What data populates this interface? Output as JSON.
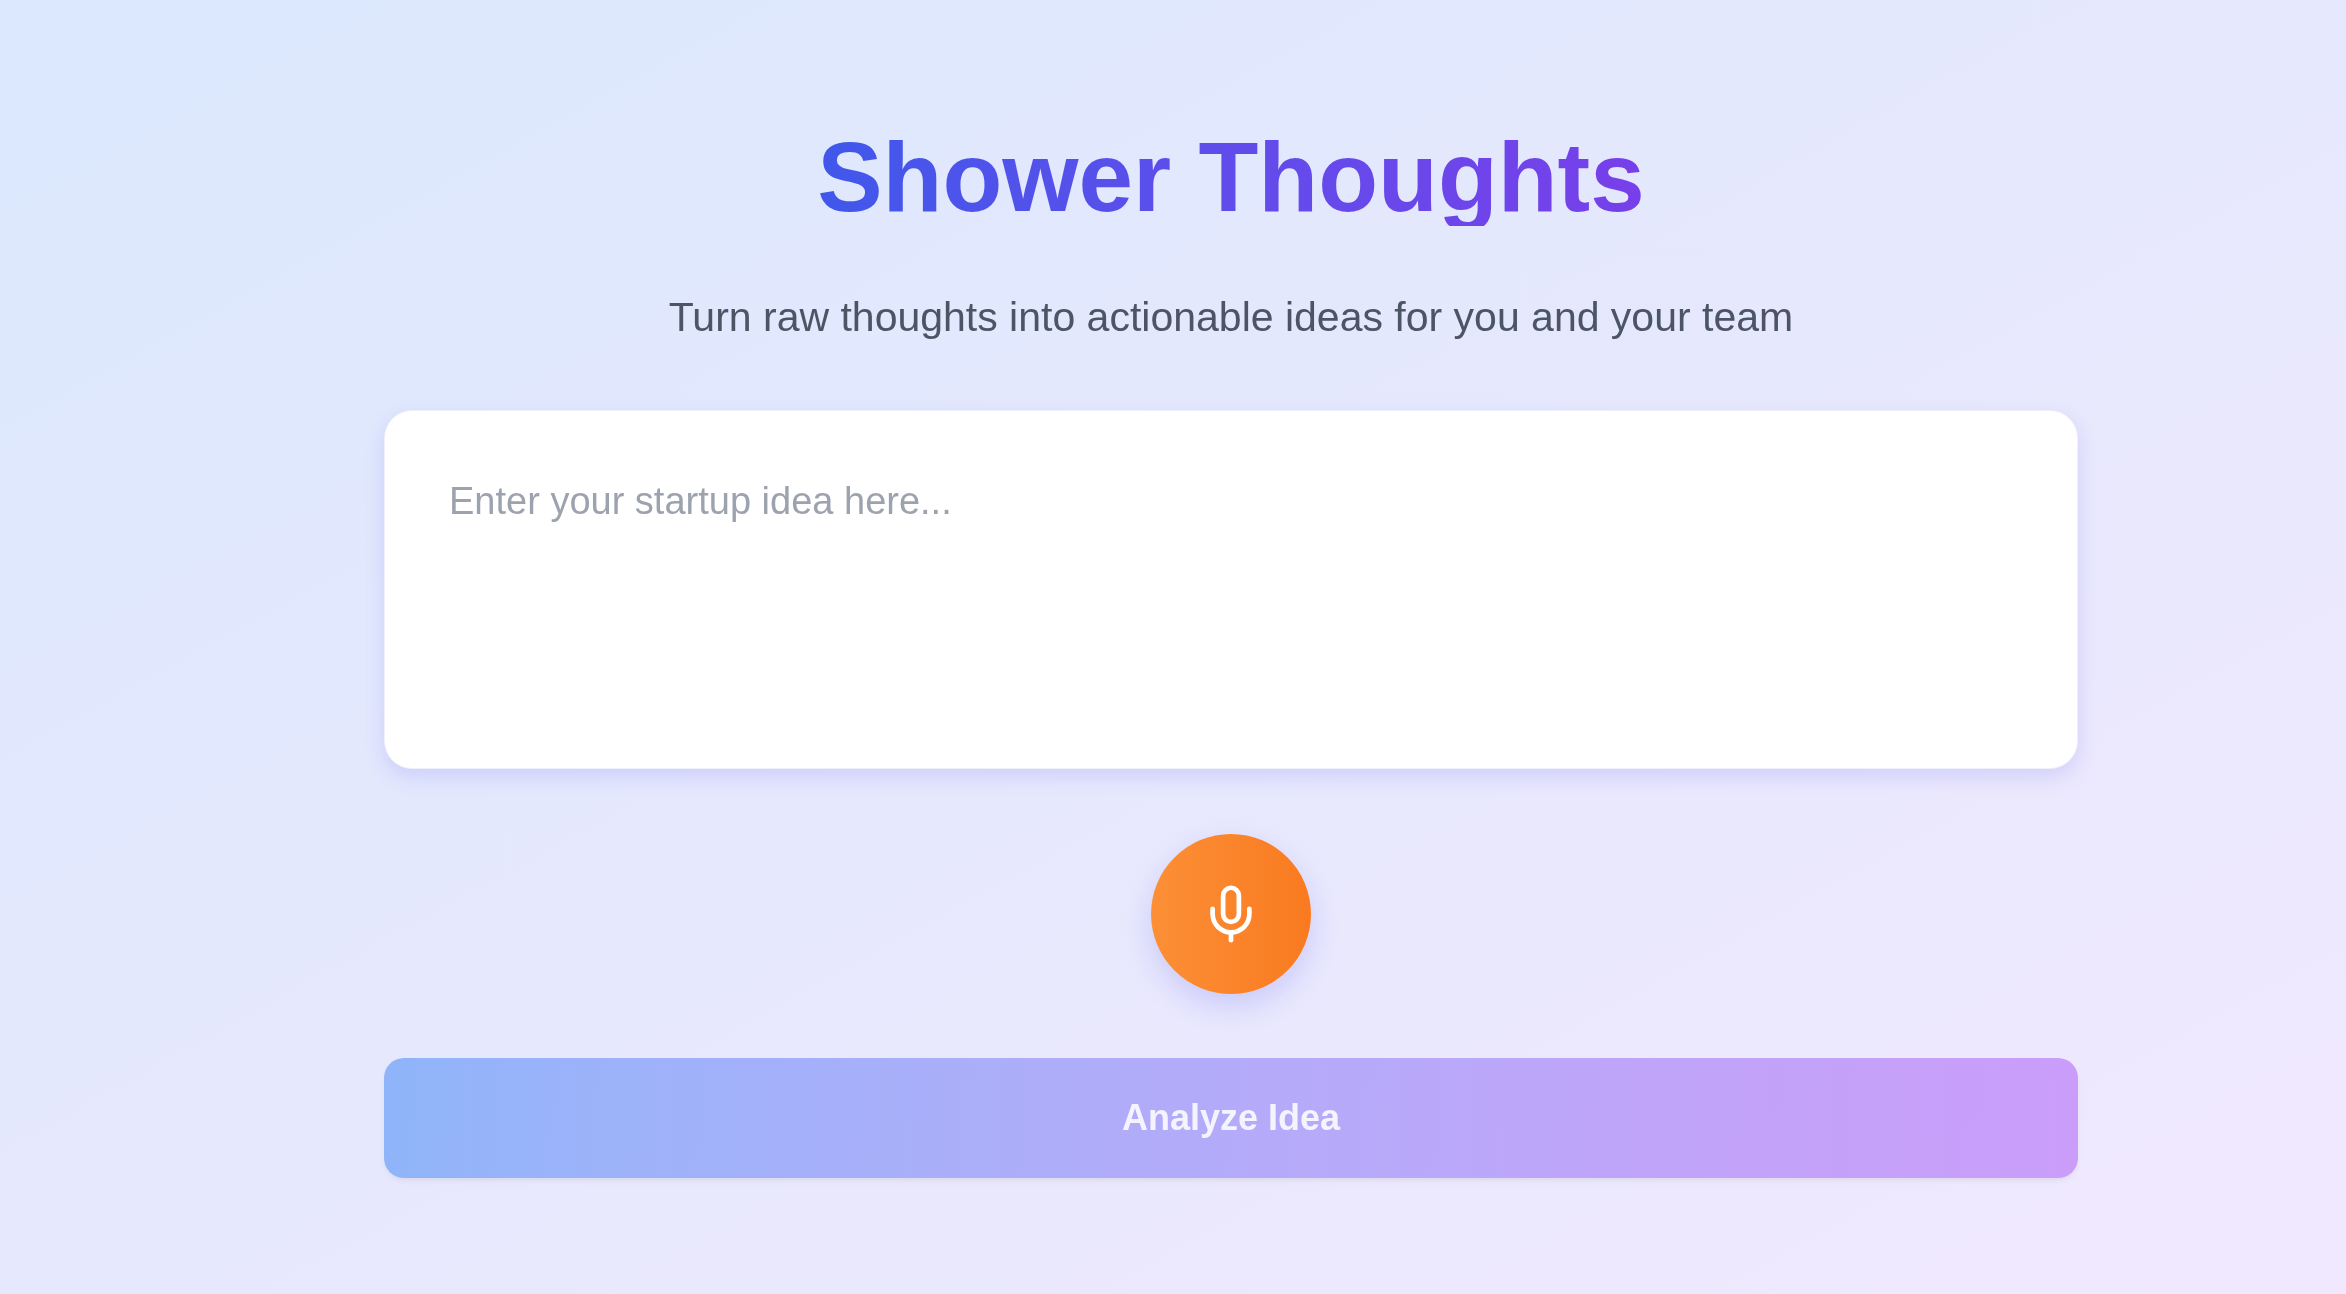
{
  "header": {
    "title": "Shower Thoughts",
    "subtitle": "Turn raw thoughts into actionable ideas for you and your team"
  },
  "idea_input": {
    "placeholder": "Enter your startup idea here..."
  },
  "analyze_button": {
    "label": "Analyze Idea",
    "disabled": true
  }
}
